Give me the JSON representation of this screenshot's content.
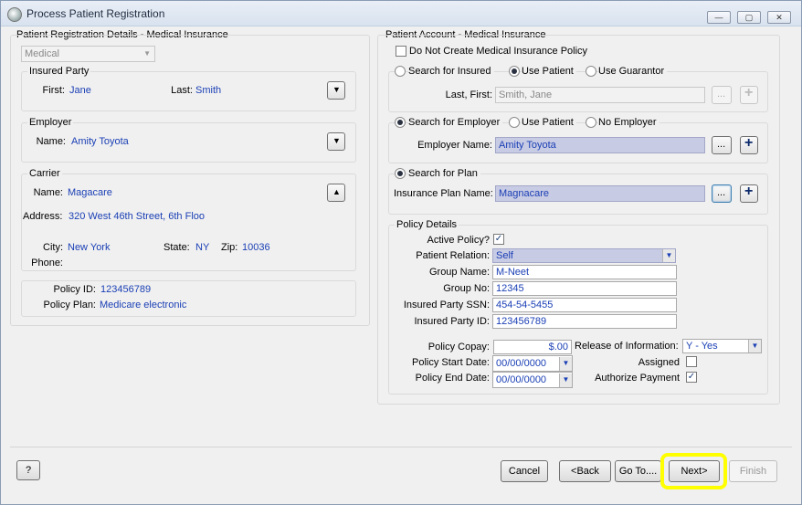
{
  "window": {
    "title": "Process Patient Registration",
    "controls": {
      "minimize": "—",
      "maximize": "▢",
      "close": "✕"
    }
  },
  "left": {
    "section_title": "Patient Registration Details - Medical Insurance",
    "insurance_type": "Medical",
    "insured_party": {
      "title": "Insured Party",
      "first_label": "First:",
      "first_value": "Jane",
      "last_label": "Last:",
      "last_value": "Smith"
    },
    "employer": {
      "title": "Employer",
      "name_label": "Name:",
      "name_value": "Amity Toyota"
    },
    "carrier": {
      "title": "Carrier",
      "name_label": "Name:",
      "name_value": "Magacare",
      "address_label": "Address:",
      "address_value": "320 West 46th Street, 6th Floo",
      "city_label": "City:",
      "city_value": "New York",
      "state_label": "State:",
      "state_value": "NY",
      "zip_label": "Zip:",
      "zip_value": "10036",
      "phone_label": "Phone:",
      "phone_value": ""
    },
    "policy": {
      "id_label": "Policy ID:",
      "id_value": "123456789",
      "plan_label": "Policy Plan:",
      "plan_value": "Medicare electronic"
    }
  },
  "right": {
    "section_title": "Patient Account - Medical Insurance",
    "do_not_create_label": "Do Not Create Medical Insurance Policy",
    "insured": {
      "opt_search": "Search for Insured",
      "opt_patient": "Use Patient",
      "opt_guarantor": "Use Guarantor",
      "lastfirst_label": "Last, First:",
      "lastfirst_value": "Smith, Jane"
    },
    "employer": {
      "opt_search": "Search for Employer",
      "opt_patient": "Use Patient",
      "opt_none": "No Employer",
      "name_label": "Employer Name:",
      "name_value": "Amity Toyota"
    },
    "plan": {
      "opt_search": "Search for Plan",
      "name_label": "Insurance Plan Name:",
      "name_value": "Magnacare"
    },
    "policy_details": {
      "title": "Policy Details",
      "active_label": "Active Policy?",
      "relation_label": "Patient Relation:",
      "relation_value": "Self",
      "group_name_label": "Group Name:",
      "group_name_value": "M-Neet",
      "group_no_label": "Group No:",
      "group_no_value": "12345",
      "ssn_label": "Insured Party SSN:",
      "ssn_value": "454-54-5455",
      "party_id_label": "Insured Party ID:",
      "party_id_value": "123456789",
      "copay_label": "Policy Copay:",
      "copay_value": "$.00",
      "release_label": "Release of Information:",
      "release_value": "Y - Yes",
      "start_label": "Policy Start Date:",
      "start_value": "00/00/0000",
      "end_label": "Policy End Date:",
      "end_value": "00/00/0000",
      "assigned_label": "Assigned",
      "authorize_label": "Authorize Payment"
    }
  },
  "footer": {
    "help": "?",
    "cancel": "Cancel",
    "back": "<Back",
    "goto": "Go To....",
    "next": "Next>",
    "finish": "Finish"
  },
  "glyphs": {
    "ellipsis": "...",
    "plus": "+",
    "check": "✓",
    "down": "▼",
    "up": "▲"
  },
  "colors": {
    "value_text": "#1a3fb5",
    "highlight_field": "#c8cbe4",
    "next_highlight": "#ffff00"
  }
}
